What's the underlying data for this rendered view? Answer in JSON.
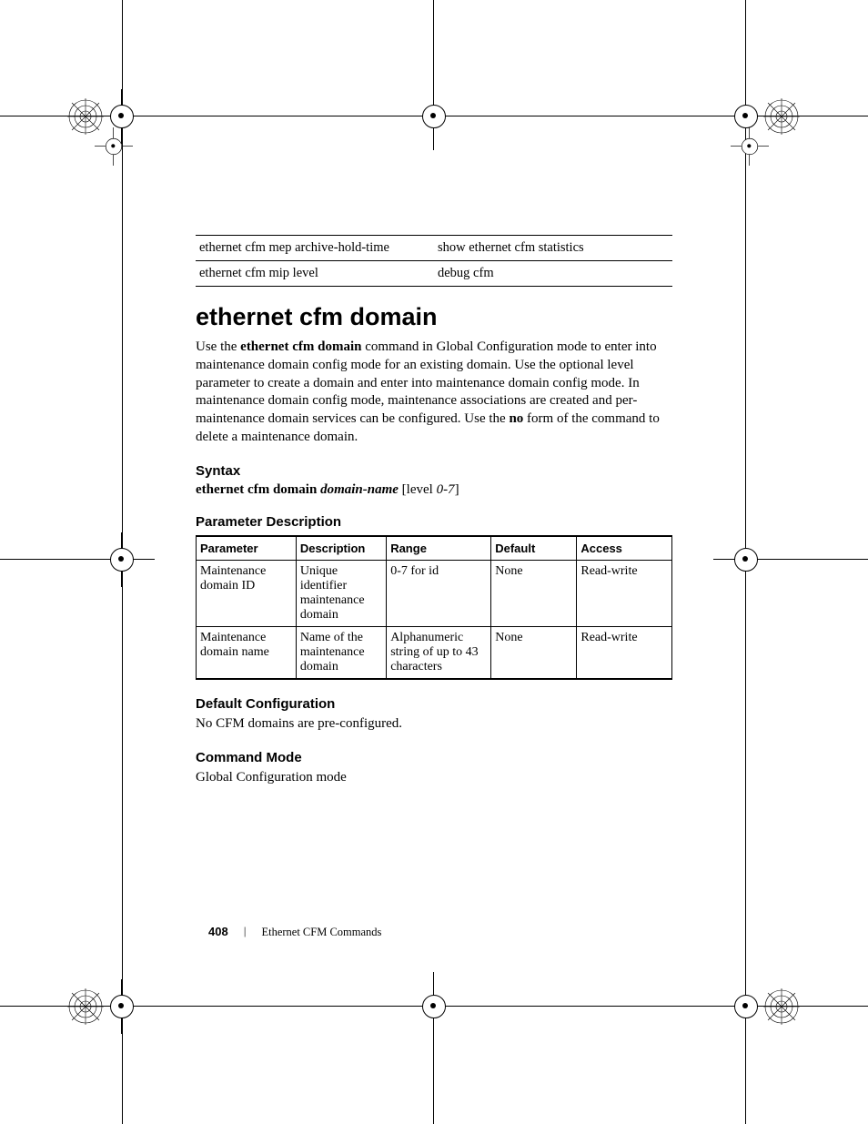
{
  "related_commands": {
    "rows": [
      [
        "ethernet cfm mep archive-hold-time",
        "show ethernet cfm statistics"
      ],
      [
        "ethernet cfm mip level",
        "debug cfm"
      ]
    ]
  },
  "heading": "ethernet cfm domain",
  "intro": {
    "pre1": "Use the ",
    "bold1": "ethernet cfm domain",
    "mid1": " command in Global Configuration mode to enter into maintenance domain config mode for an existing domain. Use the optional level parameter to create a domain and enter into maintenance domain config mode. In maintenance domain config mode, maintenance associations are created and per-maintenance domain services can be configured. Use the ",
    "bold2": "no",
    "post1": " form of the command to delete a maintenance domain."
  },
  "syntax": {
    "title": "Syntax",
    "cmd_bold": "ethernet cfm domain ",
    "arg_italic": "domain-name",
    "bracket_open": " [level ",
    "range_italic": "0-7",
    "bracket_close": "]"
  },
  "param_desc": {
    "title": "Parameter Description",
    "headers": [
      "Parameter",
      "Description",
      "Range",
      "Default",
      "Access"
    ],
    "rows": [
      {
        "p": "Maintenance domain ID",
        "d": "Unique identifier maintenance domain",
        "r": "0-7 for id",
        "def": "None",
        "a": "Read-write"
      },
      {
        "p": "Maintenance domain name",
        "d": "Name of the maintenance domain",
        "r": "Alphanumeric string of up to 43 characters",
        "def": "None",
        "a": "Read-write"
      }
    ]
  },
  "default_cfg": {
    "title": "Default Configuration",
    "body": "No CFM domains are pre-configured."
  },
  "cmd_mode": {
    "title": "Command Mode",
    "body": "Global Configuration mode"
  },
  "footer": {
    "page": "408",
    "section": "Ethernet CFM Commands"
  }
}
